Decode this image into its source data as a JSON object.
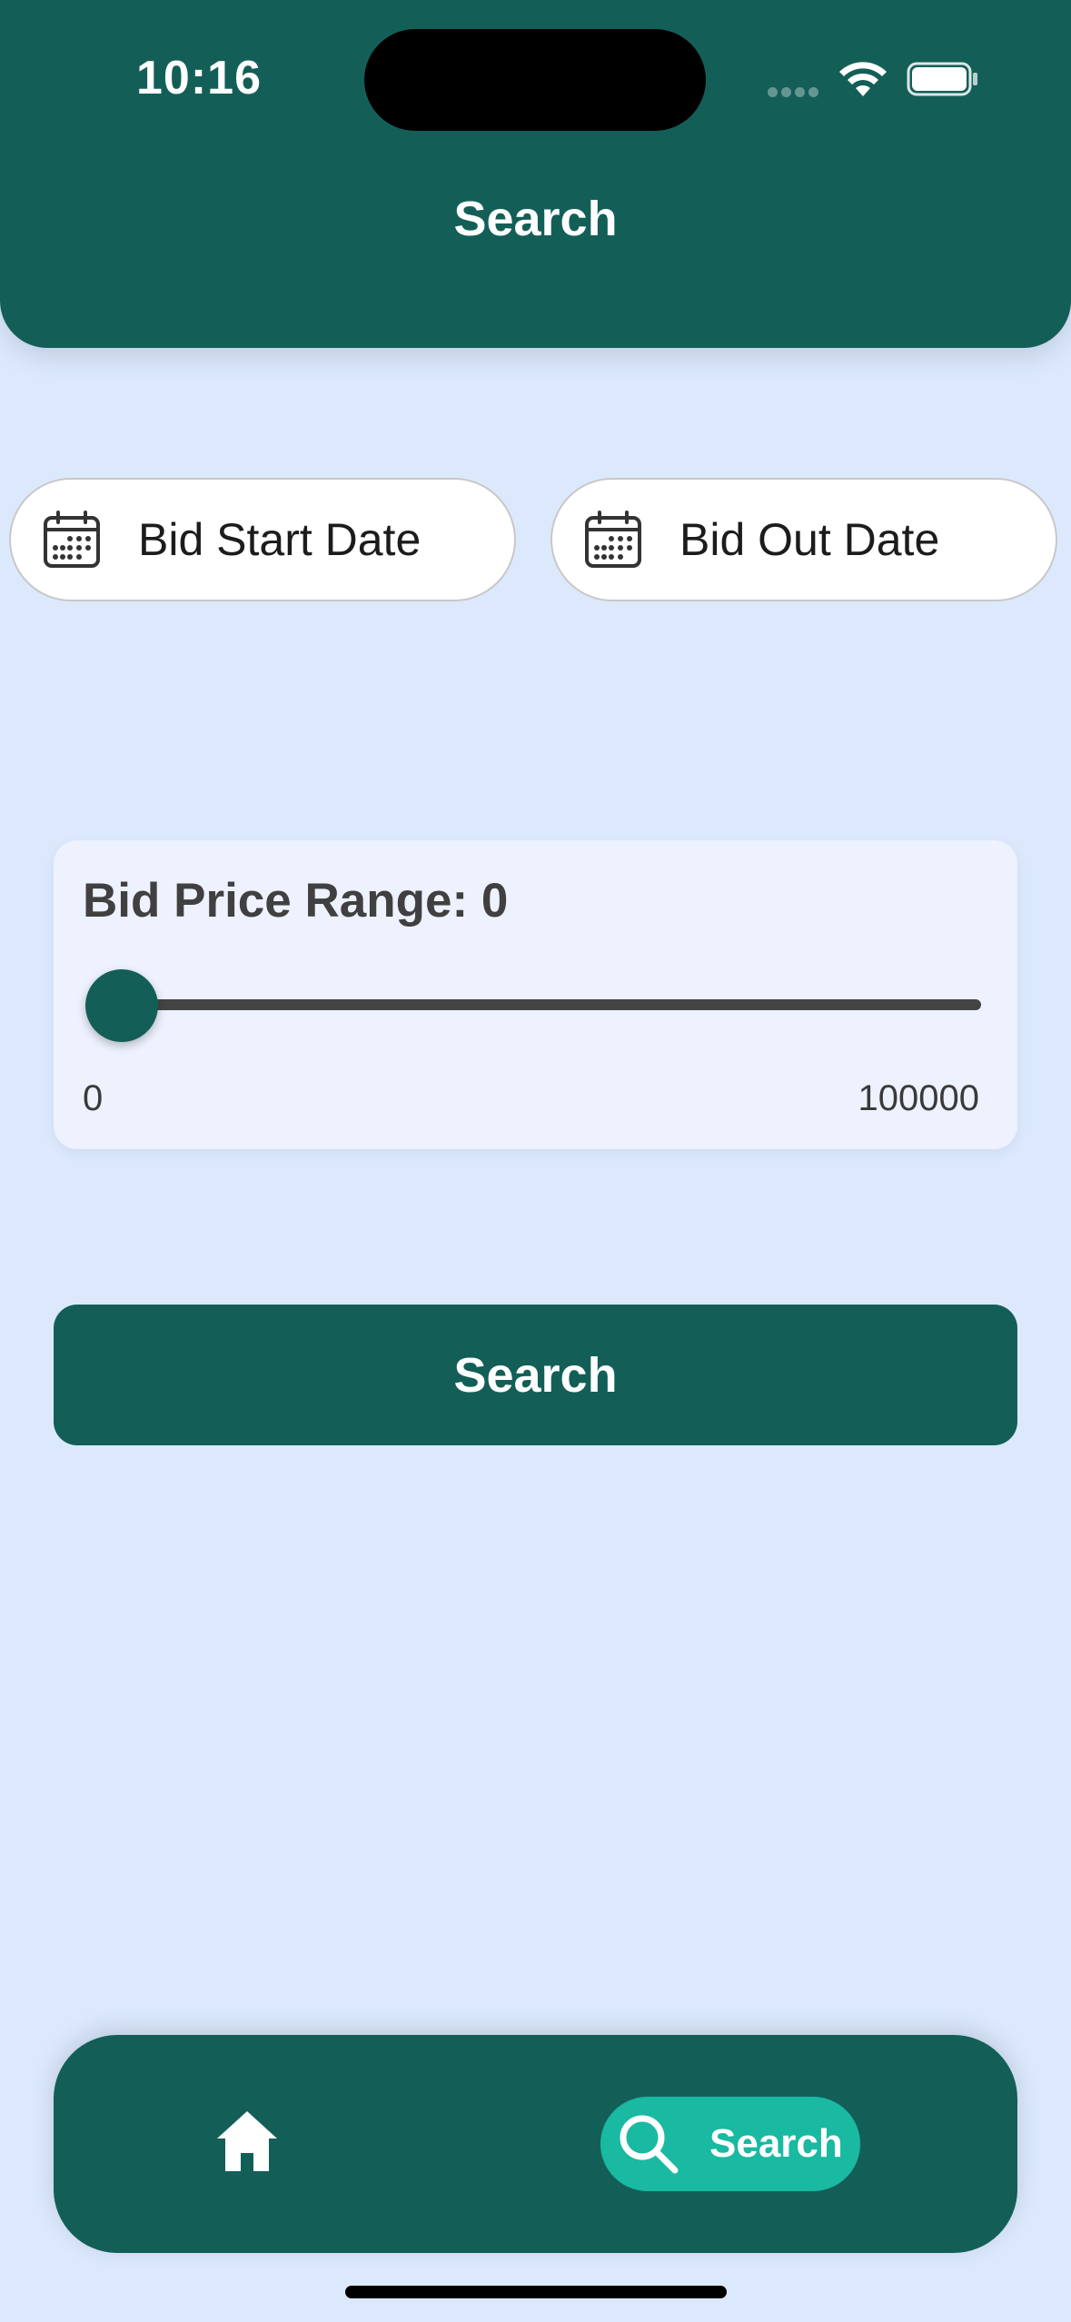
{
  "status_bar": {
    "time": "10:16"
  },
  "header": {
    "title": "Search"
  },
  "filters": {
    "start_date_label": "Bid Start Date",
    "end_date_label": "Bid Out Date"
  },
  "price_range": {
    "title": "Bid Price Range: 0",
    "min_label": "0",
    "max_label": "100000",
    "value": 0,
    "min": 0,
    "max": 100000
  },
  "search_button": {
    "label": "Search"
  },
  "bottom_nav": {
    "items": [
      {
        "icon": "home-icon",
        "label": ""
      },
      {
        "icon": "search-icon",
        "label": "Search",
        "active": true
      }
    ]
  },
  "colors": {
    "primary": "#135f58",
    "accent": "#19b9a2",
    "background": "#dce9fd",
    "card": "#edf2fe"
  }
}
